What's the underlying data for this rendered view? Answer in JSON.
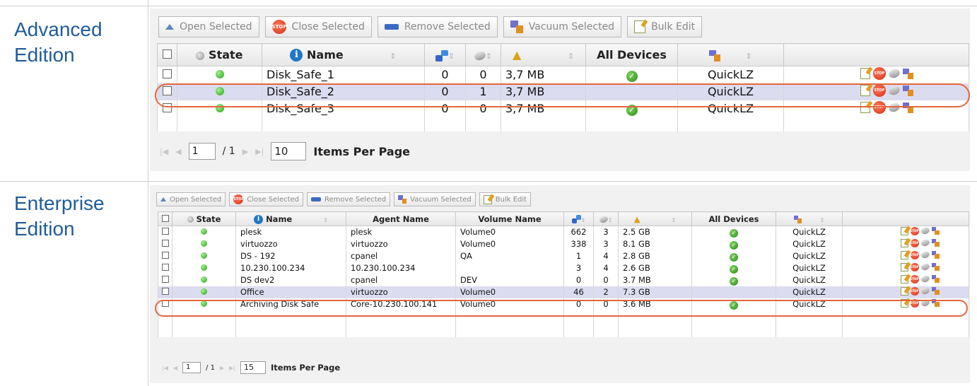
{
  "advanced": {
    "edition_label": "Advanced\nEdition",
    "toolbar": {
      "open": "Open Selected",
      "close": "Close Selected",
      "remove": "Remove Selected",
      "vacuum": "Vacuum Selected",
      "bulk": "Bulk Edit"
    },
    "headers": {
      "state": "State",
      "name": "Name",
      "all_devices": "All Devices"
    },
    "rows": [
      {
        "name": "Disk_Safe_1",
        "agents": "0",
        "disks": "0",
        "size": "3,7 MB",
        "all_devices": true,
        "compression": "QuickLZ"
      },
      {
        "name": "Disk_Safe_2",
        "agents": "0",
        "disks": "1",
        "size": "3,7 MB",
        "all_devices": false,
        "compression": "QuickLZ"
      },
      {
        "name": "Disk_Safe_3",
        "agents": "0",
        "disks": "0",
        "size": "3,7 MB",
        "all_devices": true,
        "compression": "QuickLZ"
      }
    ],
    "pager": {
      "page": "1",
      "total": "/ 1",
      "per_page": "10",
      "label": "Items Per Page"
    }
  },
  "enterprise": {
    "edition_label": "Enterprise\nEdition",
    "toolbar": {
      "open": "Open Selected",
      "close": "Close Selected",
      "remove": "Remove Selected",
      "vacuum": "Vacuum Selected",
      "bulk": "Bulk Edit"
    },
    "headers": {
      "state": "State",
      "name": "Name",
      "agent_name": "Agent Name",
      "volume_name": "Volume Name",
      "all_devices": "All Devices"
    },
    "rows": [
      {
        "name": "plesk",
        "agent": "plesk",
        "volume": "Volume0",
        "agents": "662",
        "disks": "3",
        "size": "2.5 GB",
        "all_devices": true,
        "compression": "QuickLZ"
      },
      {
        "name": "virtuozzo",
        "agent": "virtuozzo",
        "volume": "Volume0",
        "agents": "338",
        "disks": "3",
        "size": "8.1 GB",
        "all_devices": true,
        "compression": "QuickLZ"
      },
      {
        "name": "DS - 192",
        "agent": "cpanel",
        "volume": "QA",
        "agents": "1",
        "disks": "4",
        "size": "2.8 GB",
        "all_devices": true,
        "compression": "QuickLZ"
      },
      {
        "name": "10.230.100.234",
        "agent": "10.230.100.234",
        "volume": "",
        "agents": "3",
        "disks": "4",
        "size": "2.6 GB",
        "all_devices": true,
        "compression": "QuickLZ"
      },
      {
        "name": "DS dev2",
        "agent": "cpanel",
        "volume": "DEV",
        "agents": "0",
        "disks": "0",
        "size": "3.7 MB",
        "all_devices": true,
        "compression": "QuickLZ"
      },
      {
        "name": "Office",
        "agent": "virtuozzo",
        "volume": "Volume0",
        "agents": "46",
        "disks": "2",
        "size": "7.3 GB",
        "all_devices": false,
        "compression": "QuickLZ"
      },
      {
        "name": "Archiving Disk Safe",
        "agent": "Core-10.230.100.141",
        "volume": "Volume0",
        "agents": "0",
        "disks": "0",
        "size": "3.6 MB",
        "all_devices": true,
        "compression": "QuickLZ"
      }
    ],
    "pager": {
      "page": "1",
      "total": "/ 1",
      "per_page": "15",
      "label": "Items Per Page"
    }
  },
  "colors": {
    "edition_text": "#1f5c9a",
    "highlight_oval": "#e2673d",
    "highlight_row": "#dcdcf0"
  }
}
